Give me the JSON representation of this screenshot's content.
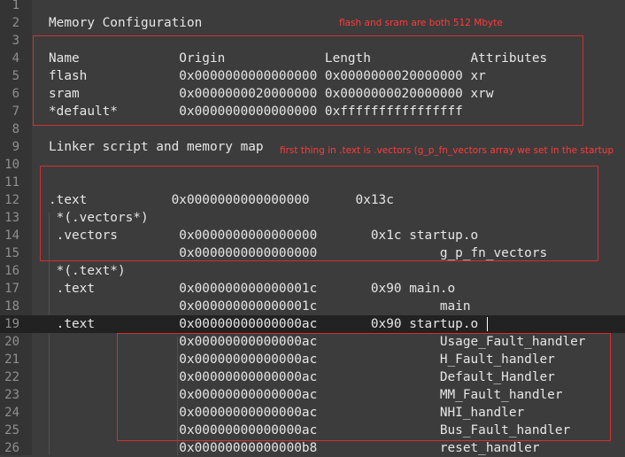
{
  "editor": {
    "lines": [
      {
        "n": "1",
        "text": ""
      },
      {
        "n": "2",
        "text": "Memory Configuration"
      },
      {
        "n": "3",
        "text": ""
      },
      {
        "n": "4",
        "text": "Name             Origin             Length             Attributes"
      },
      {
        "n": "5",
        "text": "flash            0x0000000000000000 0x0000000020000000 xr"
      },
      {
        "n": "6",
        "text": "sram             0x0000000020000000 0x0000000020000000 xrw"
      },
      {
        "n": "7",
        "text": "*default*        0x0000000000000000 0xffffffffffffffff"
      },
      {
        "n": "8",
        "text": ""
      },
      {
        "n": "9",
        "text": "Linker script and memory map"
      },
      {
        "n": "10",
        "text": ""
      },
      {
        "n": "11",
        "text": ""
      },
      {
        "n": "12",
        "text": ".text           0x0000000000000000      0x13c"
      },
      {
        "n": "13",
        "text": " *(.vectors*)"
      },
      {
        "n": "14",
        "text": " .vectors        0x0000000000000000       0x1c startup.o"
      },
      {
        "n": "15",
        "text": "                 0x0000000000000000                g_p_fn_vectors"
      },
      {
        "n": "16",
        "text": " *(.text*)"
      },
      {
        "n": "17",
        "text": " .text           0x000000000000001c       0x90 main.o"
      },
      {
        "n": "18",
        "text": "                 0x000000000000001c                main"
      },
      {
        "n": "19",
        "text": " .text           0x00000000000000ac       0x90 startup.o"
      },
      {
        "n": "20",
        "text": "                 0x00000000000000ac                Usage_Fault_handler"
      },
      {
        "n": "21",
        "text": "                 0x00000000000000ac                H_Fault_handler"
      },
      {
        "n": "22",
        "text": "                 0x00000000000000ac                Default_Handler"
      },
      {
        "n": "23",
        "text": "                 0x00000000000000ac                MM_Fault_handler"
      },
      {
        "n": "24",
        "text": "                 0x00000000000000ac                NHI_handler"
      },
      {
        "n": "25",
        "text": "                 0x00000000000000ac                Bus_Fault_handler"
      },
      {
        "n": "26",
        "text": "                 0x00000000000000b8                reset_handler"
      }
    ],
    "current_line": "19"
  },
  "annotations": {
    "memory_note": "flash and sram are both 512 Mbyte",
    "vectors_note": "first thing in .text is .vectors (g_p_fn_vectors array we set in the startup"
  },
  "colors": {
    "background": "#3c3c3c",
    "gutter": "#343434",
    "current_line": "#222222",
    "text": "#e6e6e6",
    "line_number": "#8f8f8f",
    "annotation": "#ff3b3b"
  }
}
